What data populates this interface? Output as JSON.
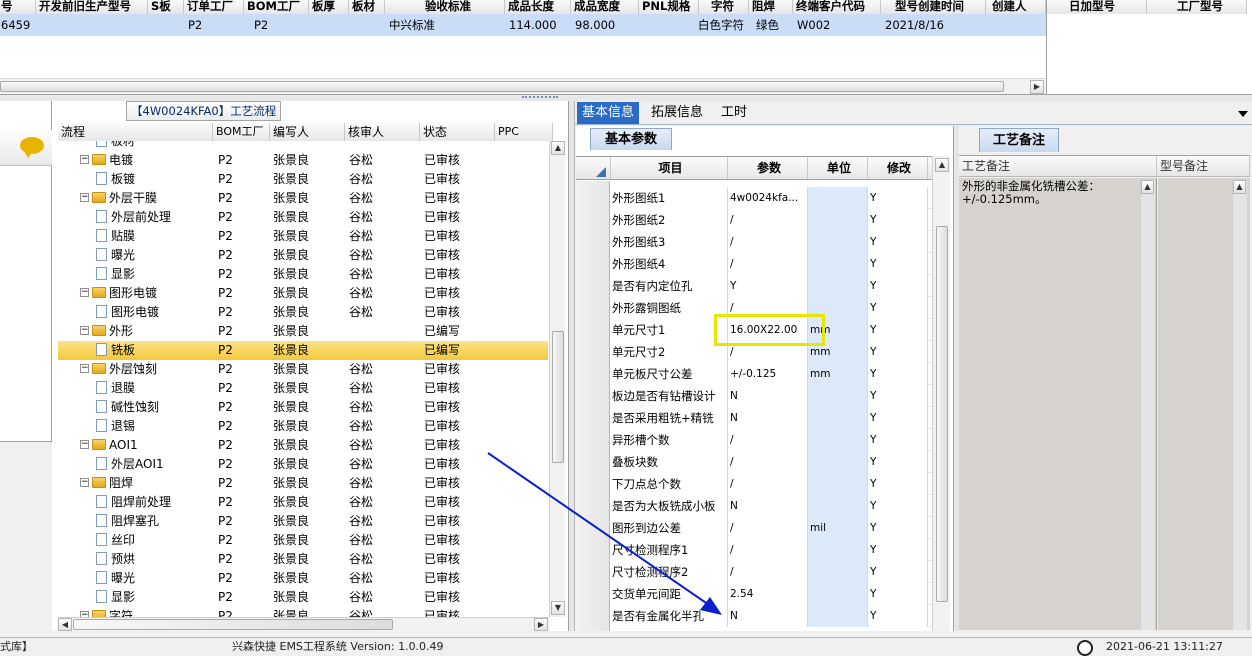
{
  "top_grid": {
    "headers": [
      "号",
      "开发前旧生产型号",
      "S板",
      "订单工厂",
      "BOM工厂",
      "板厚",
      "板材",
      "验收标准",
      "成品长度",
      "成品宽度",
      "PNL规格",
      "字符",
      "阻焊",
      "终端客户代码",
      "型号创建时间",
      "创建人"
    ],
    "row": [
      "6459",
      "",
      "",
      "P2",
      "P2",
      "",
      "",
      "中兴标准",
      "114.000",
      "98.000",
      "",
      "白色字符",
      "绿色",
      "W002",
      "2021/8/16",
      ""
    ],
    "right_headers": [
      "日加型号",
      "工厂型号"
    ]
  },
  "process_panel": {
    "title": "【4W0024KFA0】工艺流程",
    "headers": [
      "流程",
      "BOM工厂",
      "编写人",
      "核审人",
      "状态",
      "PPC"
    ],
    "rows": [
      {
        "name": "板材",
        "level": 1,
        "folder": false,
        "exp": "",
        "bom": "",
        "writer": "",
        "reviewer": "",
        "status": "",
        "sel": false
      },
      {
        "name": "电镀",
        "level": 0,
        "folder": true,
        "exp": "−",
        "bom": "P2",
        "writer": "张景良",
        "reviewer": "谷松",
        "status": "已审核",
        "sel": false
      },
      {
        "name": "板镀",
        "level": 1,
        "folder": false,
        "exp": "",
        "bom": "P2",
        "writer": "张景良",
        "reviewer": "谷松",
        "status": "已审核",
        "sel": false
      },
      {
        "name": "外层干膜",
        "level": 0,
        "folder": true,
        "exp": "−",
        "bom": "P2",
        "writer": "张景良",
        "reviewer": "谷松",
        "status": "已审核",
        "sel": false
      },
      {
        "name": "外层前处理",
        "level": 1,
        "folder": false,
        "exp": "",
        "bom": "P2",
        "writer": "张景良",
        "reviewer": "谷松",
        "status": "已审核",
        "sel": false
      },
      {
        "name": "贴膜",
        "level": 1,
        "folder": false,
        "exp": "",
        "bom": "P2",
        "writer": "张景良",
        "reviewer": "谷松",
        "status": "已审核",
        "sel": false
      },
      {
        "name": "曝光",
        "level": 1,
        "folder": false,
        "exp": "",
        "bom": "P2",
        "writer": "张景良",
        "reviewer": "谷松",
        "status": "已审核",
        "sel": false
      },
      {
        "name": "显影",
        "level": 1,
        "folder": false,
        "exp": "",
        "bom": "P2",
        "writer": "张景良",
        "reviewer": "谷松",
        "status": "已审核",
        "sel": false
      },
      {
        "name": "图形电镀",
        "level": 0,
        "folder": true,
        "exp": "−",
        "bom": "P2",
        "writer": "张景良",
        "reviewer": "谷松",
        "status": "已审核",
        "sel": false
      },
      {
        "name": "图形电镀",
        "level": 1,
        "folder": false,
        "exp": "",
        "bom": "P2",
        "writer": "张景良",
        "reviewer": "谷松",
        "status": "已审核",
        "sel": false
      },
      {
        "name": "外形",
        "level": 0,
        "folder": true,
        "exp": "−",
        "bom": "P2",
        "writer": "张景良",
        "reviewer": "",
        "status": "已编写",
        "sel": false
      },
      {
        "name": "铣板",
        "level": 1,
        "folder": false,
        "exp": "",
        "bom": "P2",
        "writer": "张景良",
        "reviewer": "",
        "status": "已编写",
        "sel": true
      },
      {
        "name": "外层蚀刻",
        "level": 0,
        "folder": true,
        "exp": "−",
        "bom": "P2",
        "writer": "张景良",
        "reviewer": "谷松",
        "status": "已审核",
        "sel": false
      },
      {
        "name": "退膜",
        "level": 1,
        "folder": false,
        "exp": "",
        "bom": "P2",
        "writer": "张景良",
        "reviewer": "谷松",
        "status": "已审核",
        "sel": false
      },
      {
        "name": "碱性蚀刻",
        "level": 1,
        "folder": false,
        "exp": "",
        "bom": "P2",
        "writer": "张景良",
        "reviewer": "谷松",
        "status": "已审核",
        "sel": false
      },
      {
        "name": "退锡",
        "level": 1,
        "folder": false,
        "exp": "",
        "bom": "P2",
        "writer": "张景良",
        "reviewer": "谷松",
        "status": "已审核",
        "sel": false
      },
      {
        "name": "AOI1",
        "level": 0,
        "folder": true,
        "exp": "−",
        "bom": "P2",
        "writer": "张景良",
        "reviewer": "谷松",
        "status": "已审核",
        "sel": false
      },
      {
        "name": "外层AOI1",
        "level": 1,
        "folder": false,
        "exp": "",
        "bom": "P2",
        "writer": "张景良",
        "reviewer": "谷松",
        "status": "已审核",
        "sel": false
      },
      {
        "name": "阻焊",
        "level": 0,
        "folder": true,
        "exp": "−",
        "bom": "P2",
        "writer": "张景良",
        "reviewer": "谷松",
        "status": "已审核",
        "sel": false
      },
      {
        "name": "阻焊前处理",
        "level": 1,
        "folder": false,
        "exp": "",
        "bom": "P2",
        "writer": "张景良",
        "reviewer": "谷松",
        "status": "已审核",
        "sel": false
      },
      {
        "name": "阻焊塞孔",
        "level": 1,
        "folder": false,
        "exp": "",
        "bom": "P2",
        "writer": "张景良",
        "reviewer": "谷松",
        "status": "已审核",
        "sel": false
      },
      {
        "name": "丝印",
        "level": 1,
        "folder": false,
        "exp": "",
        "bom": "P2",
        "writer": "张景良",
        "reviewer": "谷松",
        "status": "已审核",
        "sel": false
      },
      {
        "name": "预烘",
        "level": 1,
        "folder": false,
        "exp": "",
        "bom": "P2",
        "writer": "张景良",
        "reviewer": "谷松",
        "status": "已审核",
        "sel": false
      },
      {
        "name": "曝光",
        "level": 1,
        "folder": false,
        "exp": "",
        "bom": "P2",
        "writer": "张景良",
        "reviewer": "谷松",
        "status": "已审核",
        "sel": false
      },
      {
        "name": "显影",
        "level": 1,
        "folder": false,
        "exp": "",
        "bom": "P2",
        "writer": "张景良",
        "reviewer": "谷松",
        "status": "已审核",
        "sel": false
      },
      {
        "name": "字符",
        "level": 0,
        "folder": true,
        "exp": "−",
        "bom": "P2",
        "writer": "张景良",
        "reviewer": "谷松",
        "status": "已审核",
        "sel": false
      }
    ]
  },
  "tabs": [
    "基本信息",
    "拓展信息",
    "工时"
  ],
  "params_panel": {
    "tab": "基本参数",
    "headers": [
      "项目",
      "参数",
      "单位",
      "修改"
    ],
    "rows": [
      {
        "item": "外形图纸1",
        "value": "4w0024kfa...",
        "unit": "",
        "mod": "Y"
      },
      {
        "item": "外形图纸2",
        "value": "/",
        "unit": "",
        "mod": "Y"
      },
      {
        "item": "外形图纸3",
        "value": "/",
        "unit": "",
        "mod": "Y"
      },
      {
        "item": "外形图纸4",
        "value": "/",
        "unit": "",
        "mod": "Y"
      },
      {
        "item": "是否有内定位孔",
        "value": "Y",
        "unit": "",
        "mod": "Y"
      },
      {
        "item": "外形露铜图纸",
        "value": "/",
        "unit": "",
        "mod": "Y"
      },
      {
        "item": "单元尺寸1",
        "value": "16.00X22.00",
        "unit": "mm",
        "mod": "Y"
      },
      {
        "item": "单元尺寸2",
        "value": "/",
        "unit": "mm",
        "mod": "Y"
      },
      {
        "item": "单元板尺寸公差",
        "value": "+/-0.125",
        "unit": "mm",
        "mod": "Y"
      },
      {
        "item": "板边是否有钻槽设计",
        "value": "N",
        "unit": "",
        "mod": "Y"
      },
      {
        "item": "是否采用粗铣+精铣",
        "value": "N",
        "unit": "",
        "mod": "Y"
      },
      {
        "item": "异形槽个数",
        "value": "/",
        "unit": "",
        "mod": "Y"
      },
      {
        "item": "叠板块数",
        "value": "/",
        "unit": "",
        "mod": "Y"
      },
      {
        "item": "下刀点总个数",
        "value": "/",
        "unit": "",
        "mod": "Y"
      },
      {
        "item": "是否为大板铣成小板",
        "value": "N",
        "unit": "",
        "mod": "Y"
      },
      {
        "item": "图形到边公差",
        "value": "/",
        "unit": "mil",
        "mod": "Y"
      },
      {
        "item": "尺寸检测程序1",
        "value": "/",
        "unit": "",
        "mod": "Y"
      },
      {
        "item": "尺寸检测程序2",
        "value": "/",
        "unit": "",
        "mod": "Y"
      },
      {
        "item": "交货单元间距",
        "value": "2.54",
        "unit": "",
        "mod": "Y"
      },
      {
        "item": "是否有金属化半孔",
        "value": "N",
        "unit": "",
        "mod": "Y"
      }
    ]
  },
  "notes_panel": {
    "tab": "工艺备注",
    "headers": [
      "工艺备注",
      "型号备注"
    ],
    "process_note": "外形的非金属化铣槽公差：+/-0.125mm。",
    "model_note": ""
  },
  "status_bar": {
    "left": "式库】",
    "center": "兴森快捷 EMS工程系统 Version: 1.0.0.49",
    "time": "2021-06-21 13:11:27"
  },
  "colors": {
    "tab_active": "#2a6bc6",
    "highlight": "#f0c02a",
    "annotation": "#e6e600",
    "arrow": "#0a1fd0"
  }
}
